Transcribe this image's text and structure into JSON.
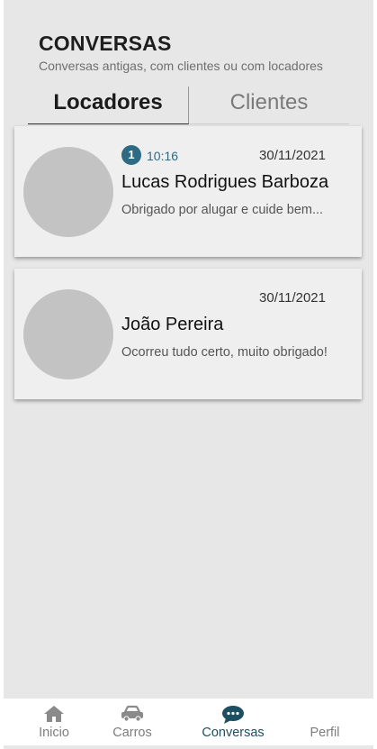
{
  "header": {
    "title": "CONVERSAS",
    "subtitle": "Conversas antigas, com clientes ou com locadores"
  },
  "tabs": [
    {
      "label": "Locadores",
      "active": true
    },
    {
      "label": "Clientes",
      "active": false
    }
  ],
  "conversations": [
    {
      "name": "Lucas Rodrigues Barboza",
      "unread": "1",
      "time": "10:16",
      "date": "30/11/2021",
      "preview": "Obrigado por alugar e cuide bem..."
    },
    {
      "name": "João Pereira",
      "date": "30/11/2021",
      "preview": "Ocorreu tudo certo, muito obrigado!"
    }
  ],
  "nav": {
    "items": [
      {
        "label": "Inicio",
        "icon": "home-icon"
      },
      {
        "label": "Carros",
        "icon": "car-icon"
      },
      {
        "label": "Conversas",
        "icon": "chat-icon",
        "active": true
      },
      {
        "label": "Perfil",
        "icon": "user-icon"
      }
    ]
  },
  "colors": {
    "accent": "#2d6a83",
    "nav_active": "#1d4f63",
    "background": "#e7e7e7",
    "card": "#efefef",
    "avatar": "#c3c3c3"
  }
}
